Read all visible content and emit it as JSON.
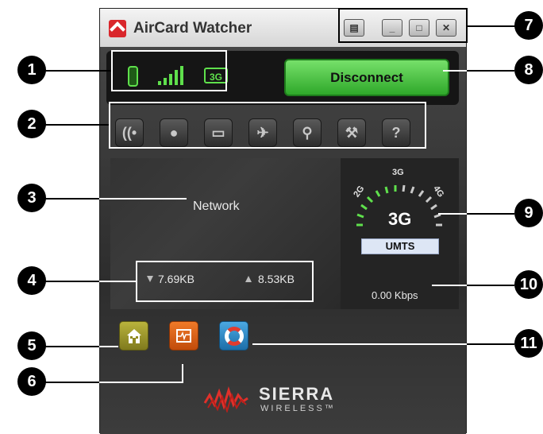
{
  "window": {
    "title": "AirCard Watcher"
  },
  "window_controls": [
    {
      "name": "menu",
      "glyph": "▤"
    },
    {
      "name": "minimize",
      "glyph": "_"
    },
    {
      "name": "maximize",
      "glyph": "□"
    },
    {
      "name": "close",
      "glyph": "✕"
    }
  ],
  "status": {
    "tech_badge": "3G",
    "signal_bars_active": 5
  },
  "disconnect_label": "Disconnect",
  "toolbar": [
    {
      "icon": "wifi-icon",
      "glyph": "((•"
    },
    {
      "icon": "sms-icon",
      "glyph": "●"
    },
    {
      "icon": "usb-icon",
      "glyph": "▭"
    },
    {
      "icon": "airplane-icon",
      "glyph": "✈"
    },
    {
      "icon": "gps-icon",
      "glyph": "⚲"
    },
    {
      "icon": "tools-icon",
      "glyph": "⚒"
    },
    {
      "icon": "help-icon",
      "glyph": "?"
    }
  ],
  "connection": {
    "network_label": "Network",
    "download": "7.69KB",
    "upload": "8.53KB"
  },
  "speed": {
    "tech": "3G",
    "gauge_labels": {
      "left": "2G",
      "top": "3G",
      "right": "4G"
    },
    "mode": "UMTS",
    "rate": "0.00 Kbps"
  },
  "brand": {
    "name": "SIERRA",
    "sub": "WIRELESS™"
  },
  "callouts": [
    "1",
    "2",
    "3",
    "4",
    "5",
    "6",
    "7",
    "8",
    "9",
    "10",
    "11"
  ],
  "colors": {
    "accent_green": "#5fe04c",
    "button_green": "#2fa82a"
  }
}
